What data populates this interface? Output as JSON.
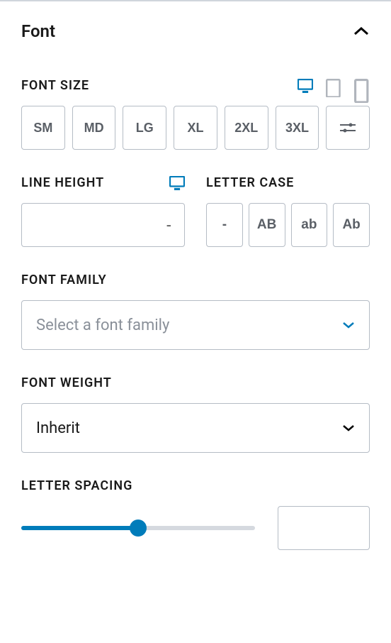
{
  "panel": {
    "title": "Font"
  },
  "fontSize": {
    "label": "FONT SIZE",
    "options": [
      "SM",
      "MD",
      "LG",
      "XL",
      "2XL",
      "3XL"
    ]
  },
  "lineHeight": {
    "label": "LINE HEIGHT",
    "value": "-"
  },
  "letterCase": {
    "label": "LETTER CASE",
    "options": [
      "-",
      "AB",
      "ab",
      "Ab"
    ]
  },
  "fontFamily": {
    "label": "FONT FAMILY",
    "placeholder": "Select a font family"
  },
  "fontWeight": {
    "label": "FONT WEIGHT",
    "value": "Inherit"
  },
  "letterSpacing": {
    "label": "LETTER SPACING",
    "value": ""
  }
}
